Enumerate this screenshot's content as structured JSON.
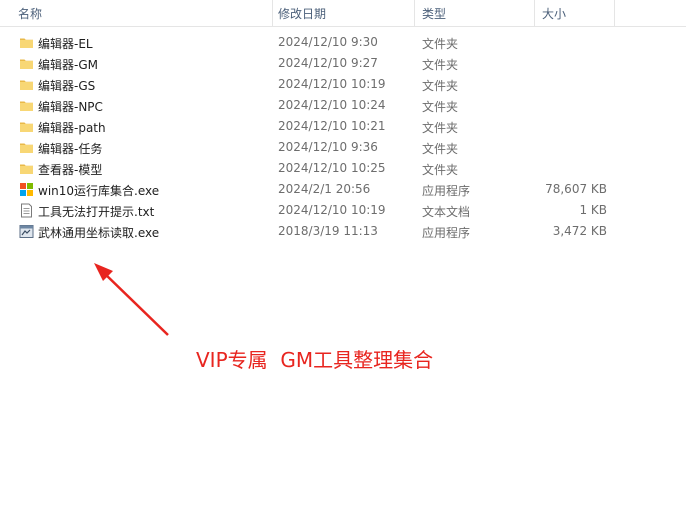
{
  "columns": {
    "name": "名称",
    "date": "修改日期",
    "type": "类型",
    "size": "大小",
    "sort_indicator": "^"
  },
  "files": [
    {
      "name": "编辑器-EL",
      "date": "2024/12/10 9:30",
      "type": "文件夹",
      "size": "",
      "icon": "folder-icon"
    },
    {
      "name": "编辑器-GM",
      "date": "2024/12/10 9:27",
      "type": "文件夹",
      "size": "",
      "icon": "folder-icon"
    },
    {
      "name": "编辑器-GS",
      "date": "2024/12/10 10:19",
      "type": "文件夹",
      "size": "",
      "icon": "folder-icon"
    },
    {
      "name": "编辑器-NPC",
      "date": "2024/12/10 10:24",
      "type": "文件夹",
      "size": "",
      "icon": "folder-icon"
    },
    {
      "name": "编辑器-path",
      "date": "2024/12/10 10:21",
      "type": "文件夹",
      "size": "",
      "icon": "folder-icon"
    },
    {
      "name": "编辑器-任务",
      "date": "2024/12/10 9:36",
      "type": "文件夹",
      "size": "",
      "icon": "folder-icon"
    },
    {
      "name": "查看器-模型",
      "date": "2024/12/10 10:25",
      "type": "文件夹",
      "size": "",
      "icon": "folder-icon"
    },
    {
      "name": "win10运行库集合.exe",
      "date": "2024/2/1 20:56",
      "type": "应用程序",
      "size": "78,607 KB",
      "icon": "windows-app-icon"
    },
    {
      "name": "工具无法打开提示.txt",
      "date": "2024/12/10 10:19",
      "type": "文本文档",
      "size": "1 KB",
      "icon": "text-document-icon"
    },
    {
      "name": "武林通用坐标读取.exe",
      "date": "2018/3/19 11:13",
      "type": "应用程序",
      "size": "3,472 KB",
      "icon": "app-window-icon"
    }
  ],
  "annotation": {
    "text": "VIP专属  GM工具整理集合",
    "color": "#e8251f"
  },
  "colors": {
    "folder": "#f8d775",
    "header_text": "#4c607a"
  }
}
